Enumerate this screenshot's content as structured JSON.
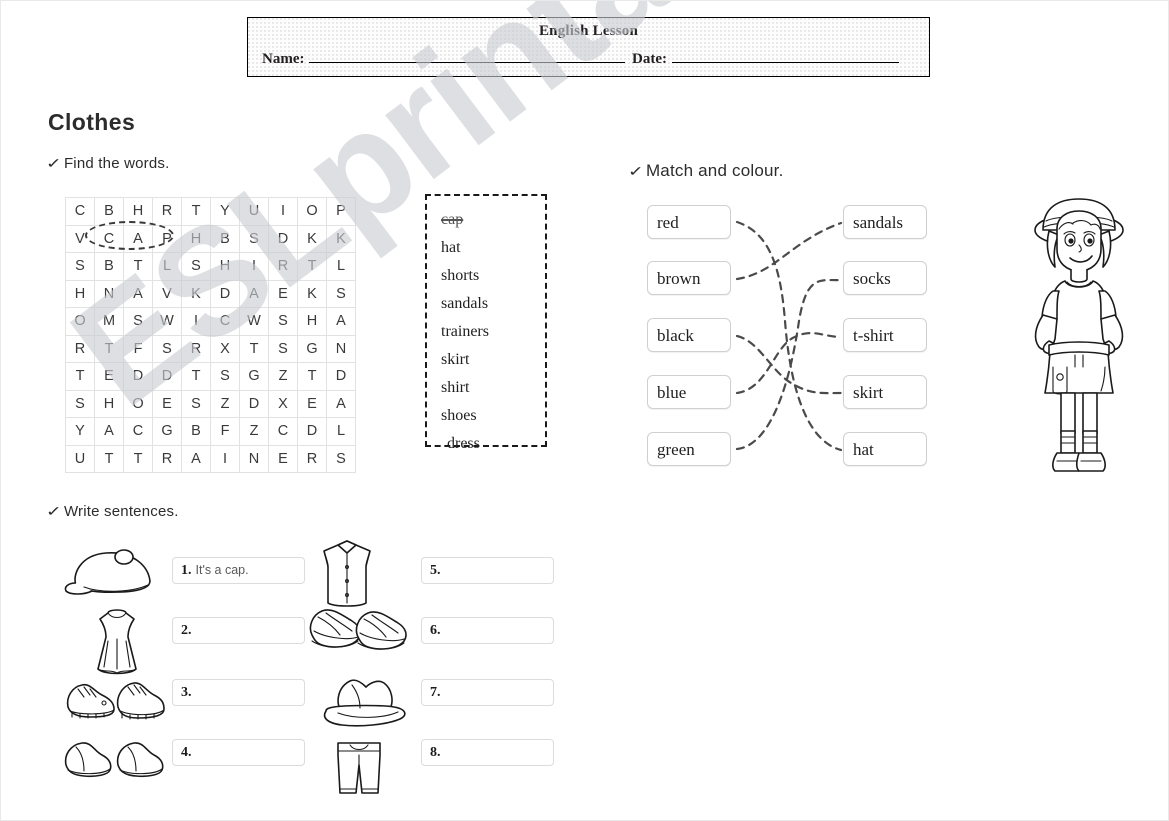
{
  "header": {
    "title": "English Lesson",
    "name_label": "Name:",
    "date_label": "Date:"
  },
  "page_title": "Clothes",
  "tasks": {
    "find": "Find the words.",
    "match": "Match and colour.",
    "write": "Write sentences."
  },
  "wordsearch": {
    "rows": [
      [
        "C",
        "B",
        "H",
        "R",
        "T",
        "Y",
        "U",
        "I",
        "O",
        "P"
      ],
      [
        "V",
        "C",
        "A",
        "P",
        "H",
        "B",
        "S",
        "D",
        "K",
        "K"
      ],
      [
        "S",
        "B",
        "T",
        "L",
        "S",
        "H",
        "I",
        "R",
        "T",
        "L"
      ],
      [
        "H",
        "N",
        "A",
        "V",
        "K",
        "D",
        "A",
        "E",
        "K",
        "S"
      ],
      [
        "O",
        "M",
        "S",
        "W",
        "I",
        "C",
        "W",
        "S",
        "H",
        "A"
      ],
      [
        "R",
        "T",
        "F",
        "S",
        "R",
        "X",
        "T",
        "S",
        "G",
        "N"
      ],
      [
        "T",
        "E",
        "D",
        "D",
        "T",
        "S",
        "G",
        "Z",
        "T",
        "D"
      ],
      [
        "S",
        "H",
        "O",
        "E",
        "S",
        "Z",
        "D",
        "X",
        "E",
        "A"
      ],
      [
        "Y",
        "A",
        "C",
        "G",
        "B",
        "F",
        "Z",
        "C",
        "D",
        "L"
      ],
      [
        "U",
        "T",
        "T",
        "R",
        "A",
        "I",
        "N",
        "E",
        "R",
        "S"
      ]
    ],
    "circled_word": "CAP"
  },
  "wordlist": [
    {
      "word": "cap",
      "found": true
    },
    {
      "word": "hat",
      "found": false
    },
    {
      "word": "shorts",
      "found": false
    },
    {
      "word": "sandals",
      "found": false
    },
    {
      "word": "trainers",
      "found": false
    },
    {
      "word": "skirt",
      "found": false
    },
    {
      "word": "shirt",
      "found": false
    },
    {
      "word": "shoes",
      "found": false
    },
    {
      "word": "dress",
      "found": false
    }
  ],
  "match": {
    "colours": [
      "red",
      "brown",
      "black",
      "blue",
      "green"
    ],
    "items": [
      "sandals",
      "socks",
      "t-shirt",
      "skirt",
      "hat"
    ],
    "pairs": [
      {
        "colour": "red",
        "item": "hat"
      },
      {
        "colour": "brown",
        "item": "sandals"
      },
      {
        "colour": "black",
        "item": "skirt"
      },
      {
        "colour": "blue",
        "item": "t-shirt"
      },
      {
        "colour": "green",
        "item": "socks"
      }
    ]
  },
  "write_sentences": [
    {
      "number": "1.",
      "answer": "It's a cap.",
      "picture": "cap"
    },
    {
      "number": "2.",
      "answer": "",
      "picture": "dress"
    },
    {
      "number": "3.",
      "answer": "",
      "picture": "trainers"
    },
    {
      "number": "4.",
      "answer": "",
      "picture": "shoes"
    },
    {
      "number": "5.",
      "answer": "",
      "picture": "shirt"
    },
    {
      "number": "6.",
      "answer": "",
      "picture": "sandals"
    },
    {
      "number": "7.",
      "answer": "",
      "picture": "hat"
    },
    {
      "number": "8.",
      "answer": "",
      "picture": "shorts"
    }
  ],
  "illustration": "girl-in-hat-dress-sandals",
  "watermark": "ESLprintables.com"
}
